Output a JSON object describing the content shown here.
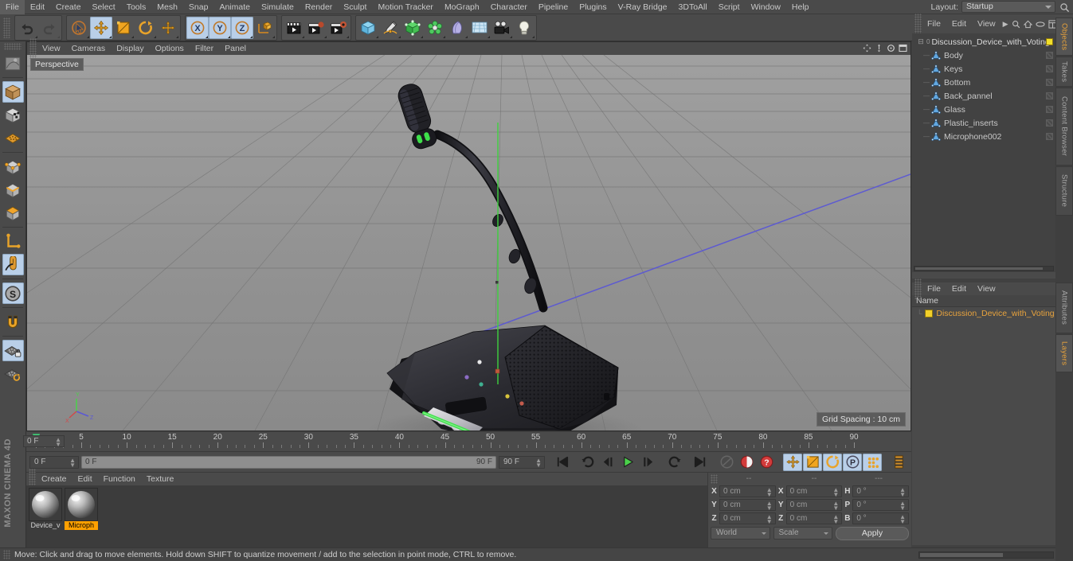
{
  "app": {
    "brand": "MAXON CINEMA 4D"
  },
  "menubar": {
    "items": [
      "File",
      "Edit",
      "Create",
      "Select",
      "Tools",
      "Mesh",
      "Snap",
      "Animate",
      "Simulate",
      "Render",
      "Sculpt",
      "Motion Tracker",
      "MoGraph",
      "Character",
      "Pipeline",
      "Plugins",
      "V-Ray Bridge",
      "3DToAll",
      "Script",
      "Window",
      "Help"
    ],
    "layout_label": "Layout:",
    "layout_value": "Startup",
    "search_icon": "search-icon"
  },
  "toolbar": {
    "buttons": [
      {
        "name": "undo-button",
        "icon": "undo-arrow-icon",
        "active": false
      },
      {
        "name": "redo-button",
        "icon": "redo-arrow-icon",
        "active": false,
        "dim": true
      },
      {
        "name": "live-selection-button",
        "icon": "cursor-circle-icon",
        "active": false
      },
      {
        "name": "move-tool-button",
        "icon": "move-arrows-icon",
        "active": true
      },
      {
        "name": "scale-tool-button",
        "icon": "scale-box-icon",
        "active": false
      },
      {
        "name": "rotate-tool-button",
        "icon": "rotate-circle-icon",
        "active": false
      },
      {
        "name": "transform-tool-button",
        "icon": "plus-move-icon",
        "active": false
      },
      {
        "name": "lock-x-axis-button",
        "icon": "x-axis-icon",
        "active": true
      },
      {
        "name": "lock-y-axis-button",
        "icon": "y-axis-icon",
        "active": true
      },
      {
        "name": "lock-z-axis-button",
        "icon": "z-axis-icon",
        "active": true
      },
      {
        "name": "world-coordinate-button",
        "icon": "world-axis-cube-icon",
        "active": false
      },
      {
        "name": "render-view-button",
        "icon": "render-clapboard-icon",
        "active": false
      },
      {
        "name": "render-region-button",
        "icon": "render-region-icon",
        "active": false
      },
      {
        "name": "render-settings-button",
        "icon": "render-settings-icon",
        "active": false
      },
      {
        "name": "add-cube-button",
        "icon": "cube-primitive-icon",
        "active": false
      },
      {
        "name": "add-spline-button",
        "icon": "pen-spline-icon",
        "active": false
      },
      {
        "name": "add-nurbs-button",
        "icon": "green-generator-icon",
        "active": false
      },
      {
        "name": "add-mograph-button",
        "icon": "mograph-cloner-icon",
        "active": false
      },
      {
        "name": "add-deformer-button",
        "icon": "bend-deformer-icon",
        "active": false
      },
      {
        "name": "add-environment-button",
        "icon": "floor-environment-icon",
        "active": false
      },
      {
        "name": "add-camera-button",
        "icon": "camera-icon",
        "active": false
      },
      {
        "name": "add-light-button",
        "icon": "light-bulb-icon",
        "active": false
      }
    ]
  },
  "left_toolbar": {
    "buttons": [
      {
        "name": "texture-axis-button",
        "icon": "texture-axis-icon",
        "active": false
      },
      {
        "name": "model-mode-button",
        "icon": "model-cube-icon",
        "active": true
      },
      {
        "name": "texture-mode-button",
        "icon": "texture-cube-icon",
        "active": false
      },
      {
        "name": "workplane-mode-button",
        "icon": "workplane-grid-icon",
        "active": false
      },
      {
        "name": "points-mode-button",
        "icon": "points-cube-icon",
        "active": false
      },
      {
        "name": "edges-mode-button",
        "icon": "edges-cube-icon",
        "active": false
      },
      {
        "name": "polygons-mode-button",
        "icon": "polygons-cube-icon",
        "active": false
      },
      {
        "name": "object-axis-button",
        "icon": "axis-l-icon",
        "active": false
      },
      {
        "name": "viewport-solo-button",
        "icon": "mouse-cursor-icon",
        "active": true
      },
      {
        "name": "snap-settings-button",
        "icon": "s-circle-icon",
        "active": true
      },
      {
        "name": "magnet-button",
        "icon": "magnet-icon",
        "active": false
      },
      {
        "name": "workplane-lock-button",
        "icon": "workplane-lock-icon",
        "active": true
      },
      {
        "name": "workplane-align-button",
        "icon": "workplane-align-icon",
        "active": false
      }
    ]
  },
  "viewport": {
    "menu": [
      "View",
      "Cameras",
      "Display",
      "Options",
      "Filter",
      "Panel"
    ],
    "view_label": "Perspective",
    "grid_spacing": "Grid Spacing : 10 cm",
    "nav_icons": [
      "pan-icon",
      "zoom-icon",
      "rotate-icon",
      "maximize-icon"
    ],
    "colors": {
      "background_top": "#9a9a9a",
      "background_bottom": "#8d8d8d",
      "grid_line": "#6f6f6f",
      "axis_y": "#4adf4a",
      "axis_z": "#5a57d0",
      "axis_x": "#d04a4a",
      "device_body": "#25252a",
      "led_green": "#3ee04a"
    }
  },
  "timeline": {
    "ticks": [
      0,
      5,
      10,
      15,
      20,
      25,
      30,
      35,
      40,
      45,
      50,
      55,
      60,
      65,
      70,
      75,
      80,
      85,
      90
    ],
    "current_frame": "0 F",
    "end_frame_field": "0 F",
    "range_start": "0 F",
    "range_end": "90 F",
    "preview_end": "90 F",
    "playhead_frame": 0
  },
  "transport": {
    "buttons": [
      {
        "name": "goto-start-button",
        "icon": "skip-start-icon",
        "active": false
      },
      {
        "name": "previous-key-button",
        "icon": "prev-key-icon",
        "active": false
      },
      {
        "name": "play-backwards-button",
        "icon": "play-back-icon",
        "active": false
      },
      {
        "name": "play-forward-button",
        "icon": "play-icon",
        "active": false
      },
      {
        "name": "next-frame-button",
        "icon": "next-frame-icon",
        "active": false
      },
      {
        "name": "next-key-button",
        "icon": "next-key-icon",
        "active": false
      },
      {
        "name": "goto-end-button",
        "icon": "skip-end-icon",
        "active": false
      },
      {
        "name": "record-active-objects-button",
        "icon": "record-disabled-icon",
        "active": false
      },
      {
        "name": "autokeying-button",
        "icon": "autokey-red-icon",
        "active": false
      },
      {
        "name": "keyframe-selection-button",
        "icon": "question-red-icon",
        "active": false
      },
      {
        "name": "position-key-button",
        "icon": "position-key-icon",
        "active": true
      },
      {
        "name": "scale-key-button",
        "icon": "scale-key-icon",
        "active": true
      },
      {
        "name": "rotation-key-button",
        "icon": "rotation-key-icon",
        "active": true
      },
      {
        "name": "parameter-key-button",
        "icon": "parameter-p-icon",
        "active": true
      },
      {
        "name": "pla-key-button",
        "icon": "pla-dots-icon",
        "active": true
      },
      {
        "name": "keyframe-layout-button",
        "icon": "keyframe-panel-icon",
        "active": false
      }
    ]
  },
  "material_manager": {
    "menu": [
      "Create",
      "Edit",
      "Function",
      "Texture"
    ],
    "materials": [
      {
        "name": "Device_v",
        "selected": false
      },
      {
        "name": "Microph",
        "selected": true
      }
    ]
  },
  "coordinates": {
    "headers": [
      "--",
      "--",
      "---"
    ],
    "rows": [
      {
        "label1": "X",
        "value1": "0 cm",
        "label2": "X",
        "value2": "0 cm",
        "label3": "H",
        "value3": "0 °"
      },
      {
        "label1": "Y",
        "value1": "0 cm",
        "label2": "Y",
        "value2": "0 cm",
        "label3": "P",
        "value3": "0 °"
      },
      {
        "label1": "Z",
        "value1": "0 cm",
        "label2": "Z",
        "value2": "0 cm",
        "label3": "B",
        "value3": "0 °"
      }
    ],
    "system": "World",
    "mode": "Scale",
    "apply_label": "Apply"
  },
  "object_manager": {
    "menu": [
      "File",
      "Edit",
      "View"
    ],
    "menu_icons": [
      "arrow-right-icon",
      "search-icon",
      "home-icon",
      "ellipse-icon",
      "layout-icon"
    ],
    "root": {
      "name": "Discussion_Device_with_Voting",
      "level_badge": "0",
      "tag_color": "#f2e02a"
    },
    "children": [
      {
        "name": "Body"
      },
      {
        "name": "Keys"
      },
      {
        "name": "Bottom"
      },
      {
        "name": "Back_pannel"
      },
      {
        "name": "Glass"
      },
      {
        "name": "Plastic_inserts"
      },
      {
        "name": "Microphone002"
      }
    ]
  },
  "attribute_manager": {
    "menu": [
      "File",
      "Edit",
      "View"
    ],
    "column_header": "Name",
    "layers": [
      {
        "name": "Discussion_Device_with_Voting",
        "color": "#f2d02a"
      }
    ]
  },
  "vertical_tabs": {
    "top": [
      {
        "label": "Objects",
        "active": true
      },
      {
        "label": "Takes",
        "active": false
      },
      {
        "label": "Content Browser",
        "active": false
      },
      {
        "label": "Structure",
        "active": false
      }
    ],
    "bottom": [
      {
        "label": "Attributes",
        "active": false
      },
      {
        "label": "Layers",
        "active": true
      }
    ]
  },
  "statusbar": {
    "message": "Move: Click and drag to move elements. Hold down SHIFT to quantize movement / add to the selection in point mode, CTRL to remove."
  }
}
